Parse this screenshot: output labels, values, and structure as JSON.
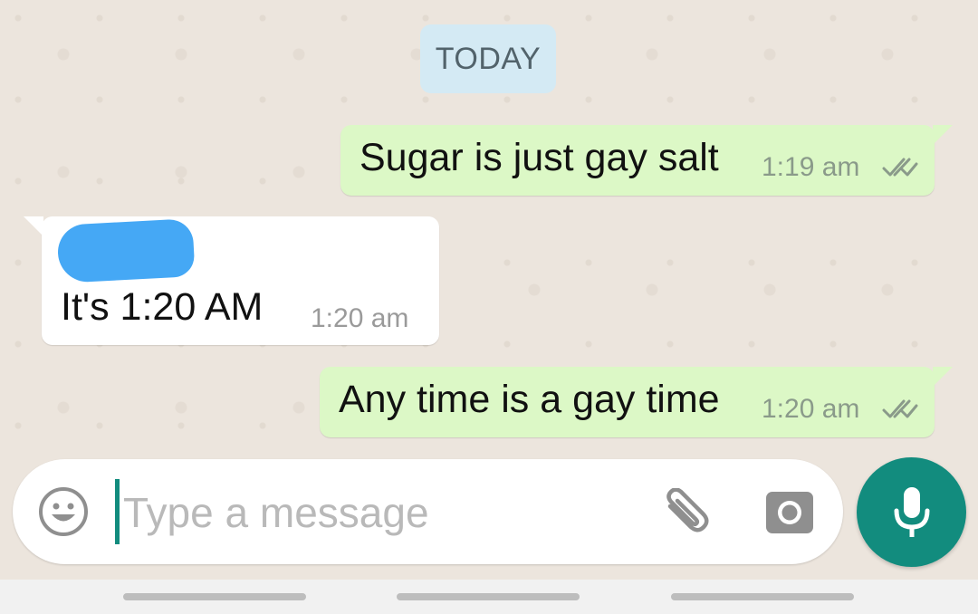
{
  "date_separator": "TODAY",
  "messages": [
    {
      "direction": "outgoing",
      "text": "Sugar is just gay salt",
      "time": "1:19 am",
      "status": "read-ticks"
    },
    {
      "direction": "incoming",
      "sender": "",
      "text": "It's 1:20 AM",
      "time": "1:20 am"
    },
    {
      "direction": "outgoing",
      "text": "Any time is a gay time",
      "time": "1:20 am",
      "status": "read-ticks"
    }
  ],
  "composer": {
    "placeholder": "Type a message",
    "value": "",
    "emoji_icon": "emoji-icon",
    "attach_icon": "paperclip-icon",
    "camera_icon": "camera-icon",
    "send_icon": "microphone-icon"
  },
  "colors": {
    "chat_background": "#ece5dd",
    "outgoing_bubble": "#dcf8c6",
    "incoming_bubble": "#ffffff",
    "date_chip": "#d4eaf4",
    "accent": "#128c7e",
    "redaction": "#45a8f5"
  }
}
